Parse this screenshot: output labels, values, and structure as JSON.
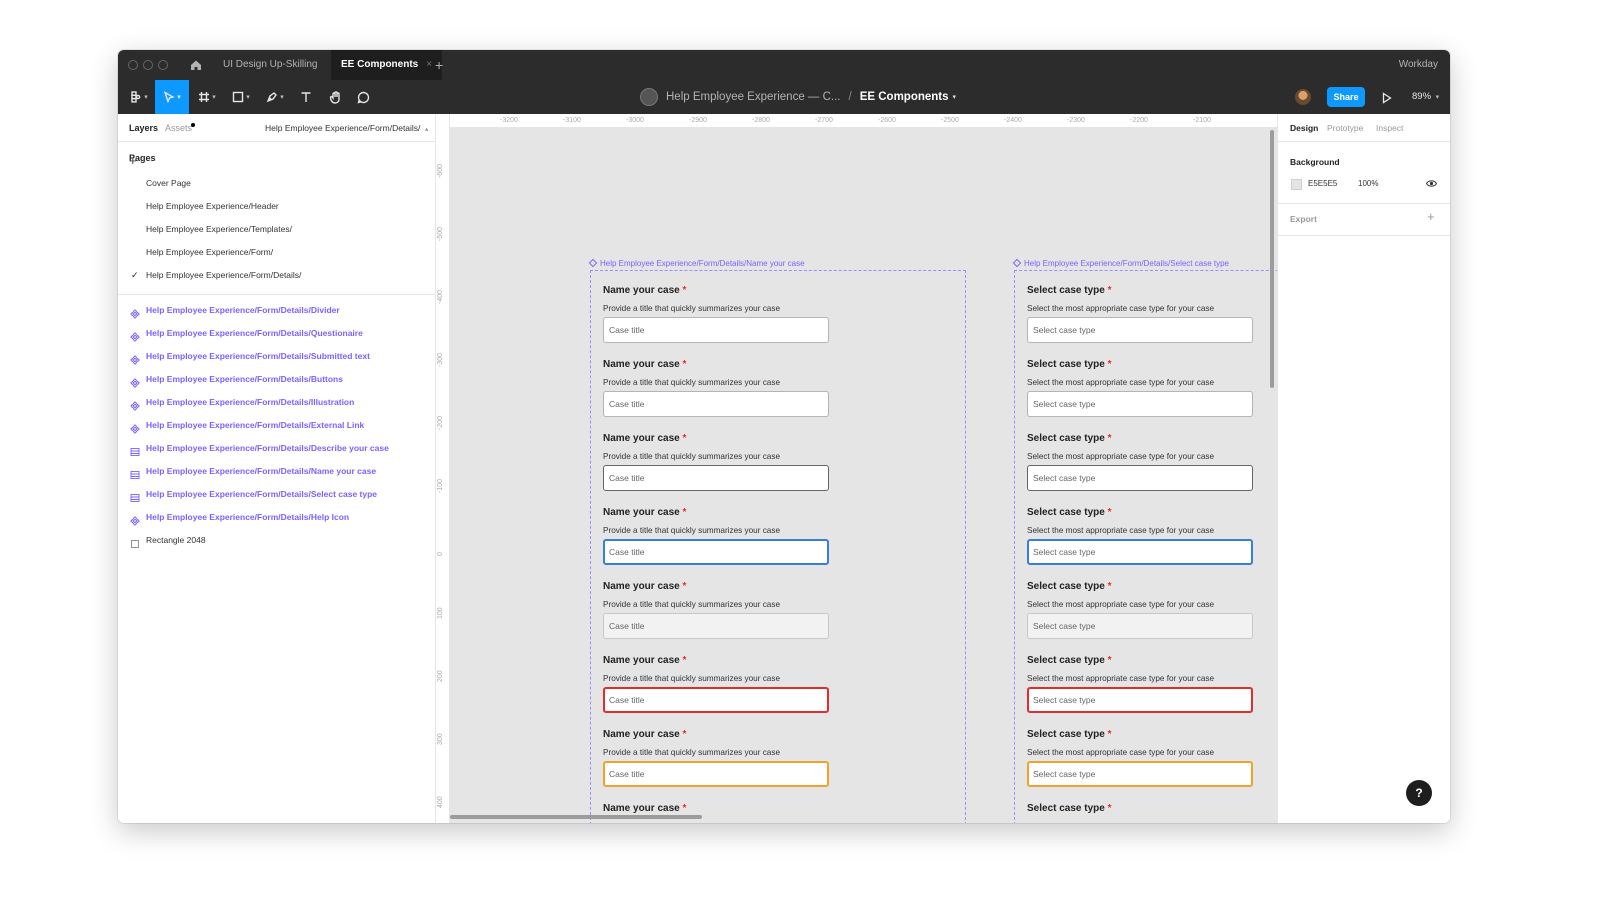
{
  "titlebar": {
    "tabs": [
      {
        "label": "UI Design Up-Skilling"
      },
      {
        "label": "EE Components",
        "close": "×"
      }
    ],
    "add_tab": "+",
    "org": "Workday"
  },
  "toolbar": {
    "breadcrumb_project": "Help Employee Experience — C...",
    "separator": "/",
    "file_name": "EE Components",
    "share_label": "Share",
    "zoom": "89%"
  },
  "left_panel": {
    "tabs": {
      "layers": "Layers",
      "assets": "Assets"
    },
    "page_path": "Help Employee Experience/Form/Details/",
    "pages_title": "Pages",
    "add_page": "+",
    "pages": [
      {
        "label": "Cover Page"
      },
      {
        "label": "Help Employee Experience/Header"
      },
      {
        "label": "Help Employee Experience/Templates/"
      },
      {
        "label": "Help Employee Experience/Form/"
      },
      {
        "label": "Help Employee Experience/Form/Details/",
        "check": "✓"
      }
    ],
    "layers": [
      {
        "label": "Help Employee Experience/Form/Details/Divider",
        "icon": "component-icon"
      },
      {
        "label": "Help Employee Experience/Form/Details/Questionaire",
        "icon": "component-icon"
      },
      {
        "label": "Help Employee Experience/Form/Details/Submitted text",
        "icon": "component-icon"
      },
      {
        "label": "Help Employee Experience/Form/Details/Buttons",
        "icon": "component-icon"
      },
      {
        "label": "Help Employee Experience/Form/Details/Illustration",
        "icon": "component-icon"
      },
      {
        "label": "Help Employee Experience/Form/Details/External Link",
        "icon": "component-icon"
      },
      {
        "label": "Help Employee Experience/Form/Details/Describe your case",
        "icon": "frame-icon"
      },
      {
        "label": "Help Employee Experience/Form/Details/Name your case",
        "icon": "frame-icon"
      },
      {
        "label": "Help Employee Experience/Form/Details/Select case type",
        "icon": "frame-icon"
      },
      {
        "label": "Help Employee Experience/Form/Details/Help Icon",
        "icon": "component-icon"
      },
      {
        "label": "Rectangle 2048",
        "icon": "rectangle-icon"
      }
    ]
  },
  "canvas": {
    "ruler_top": [
      "-3200",
      "-3100",
      "-3000",
      "-2900",
      "-2800",
      "-2700",
      "-2600",
      "-2500",
      "-2400",
      "-2300",
      "-2200",
      "-2100"
    ],
    "ruler_left": [
      "-600",
      "-500",
      "-400",
      "-300",
      "-200",
      "-100",
      "0",
      "100",
      "200",
      "300",
      "400"
    ],
    "frames": [
      {
        "label": "Help Employee Experience/Form/Details/Name your case",
        "field_label": "Name your case",
        "required": "*",
        "help": "Provide a title that quickly summarizes your case",
        "placeholder": "Case title"
      },
      {
        "label": "Help Employee Experience/Form/Details/Select case type",
        "field_label": "Select case type",
        "required": "*",
        "help": "Select the most appropriate case type for your case",
        "placeholder": "Select case type"
      }
    ],
    "states": [
      "default",
      "default",
      "hover",
      "focus",
      "disabled",
      "error",
      "warning",
      "label-only"
    ]
  },
  "right_panel": {
    "tabs": {
      "design": "Design",
      "prototype": "Prototype",
      "inspect": "Inspect"
    },
    "background_title": "Background",
    "background_hex": "E5E5E5",
    "background_opacity": "100%",
    "export_title": "Export",
    "export_add": "+"
  },
  "help_button": "?",
  "colors": {
    "accent": "#0d99ff",
    "component_purple": "#7b61ff",
    "error": "#de2d2d",
    "warning": "#f0a32c",
    "focus": "#3b7dd8",
    "canvas_bg": "#e5e5e5"
  }
}
